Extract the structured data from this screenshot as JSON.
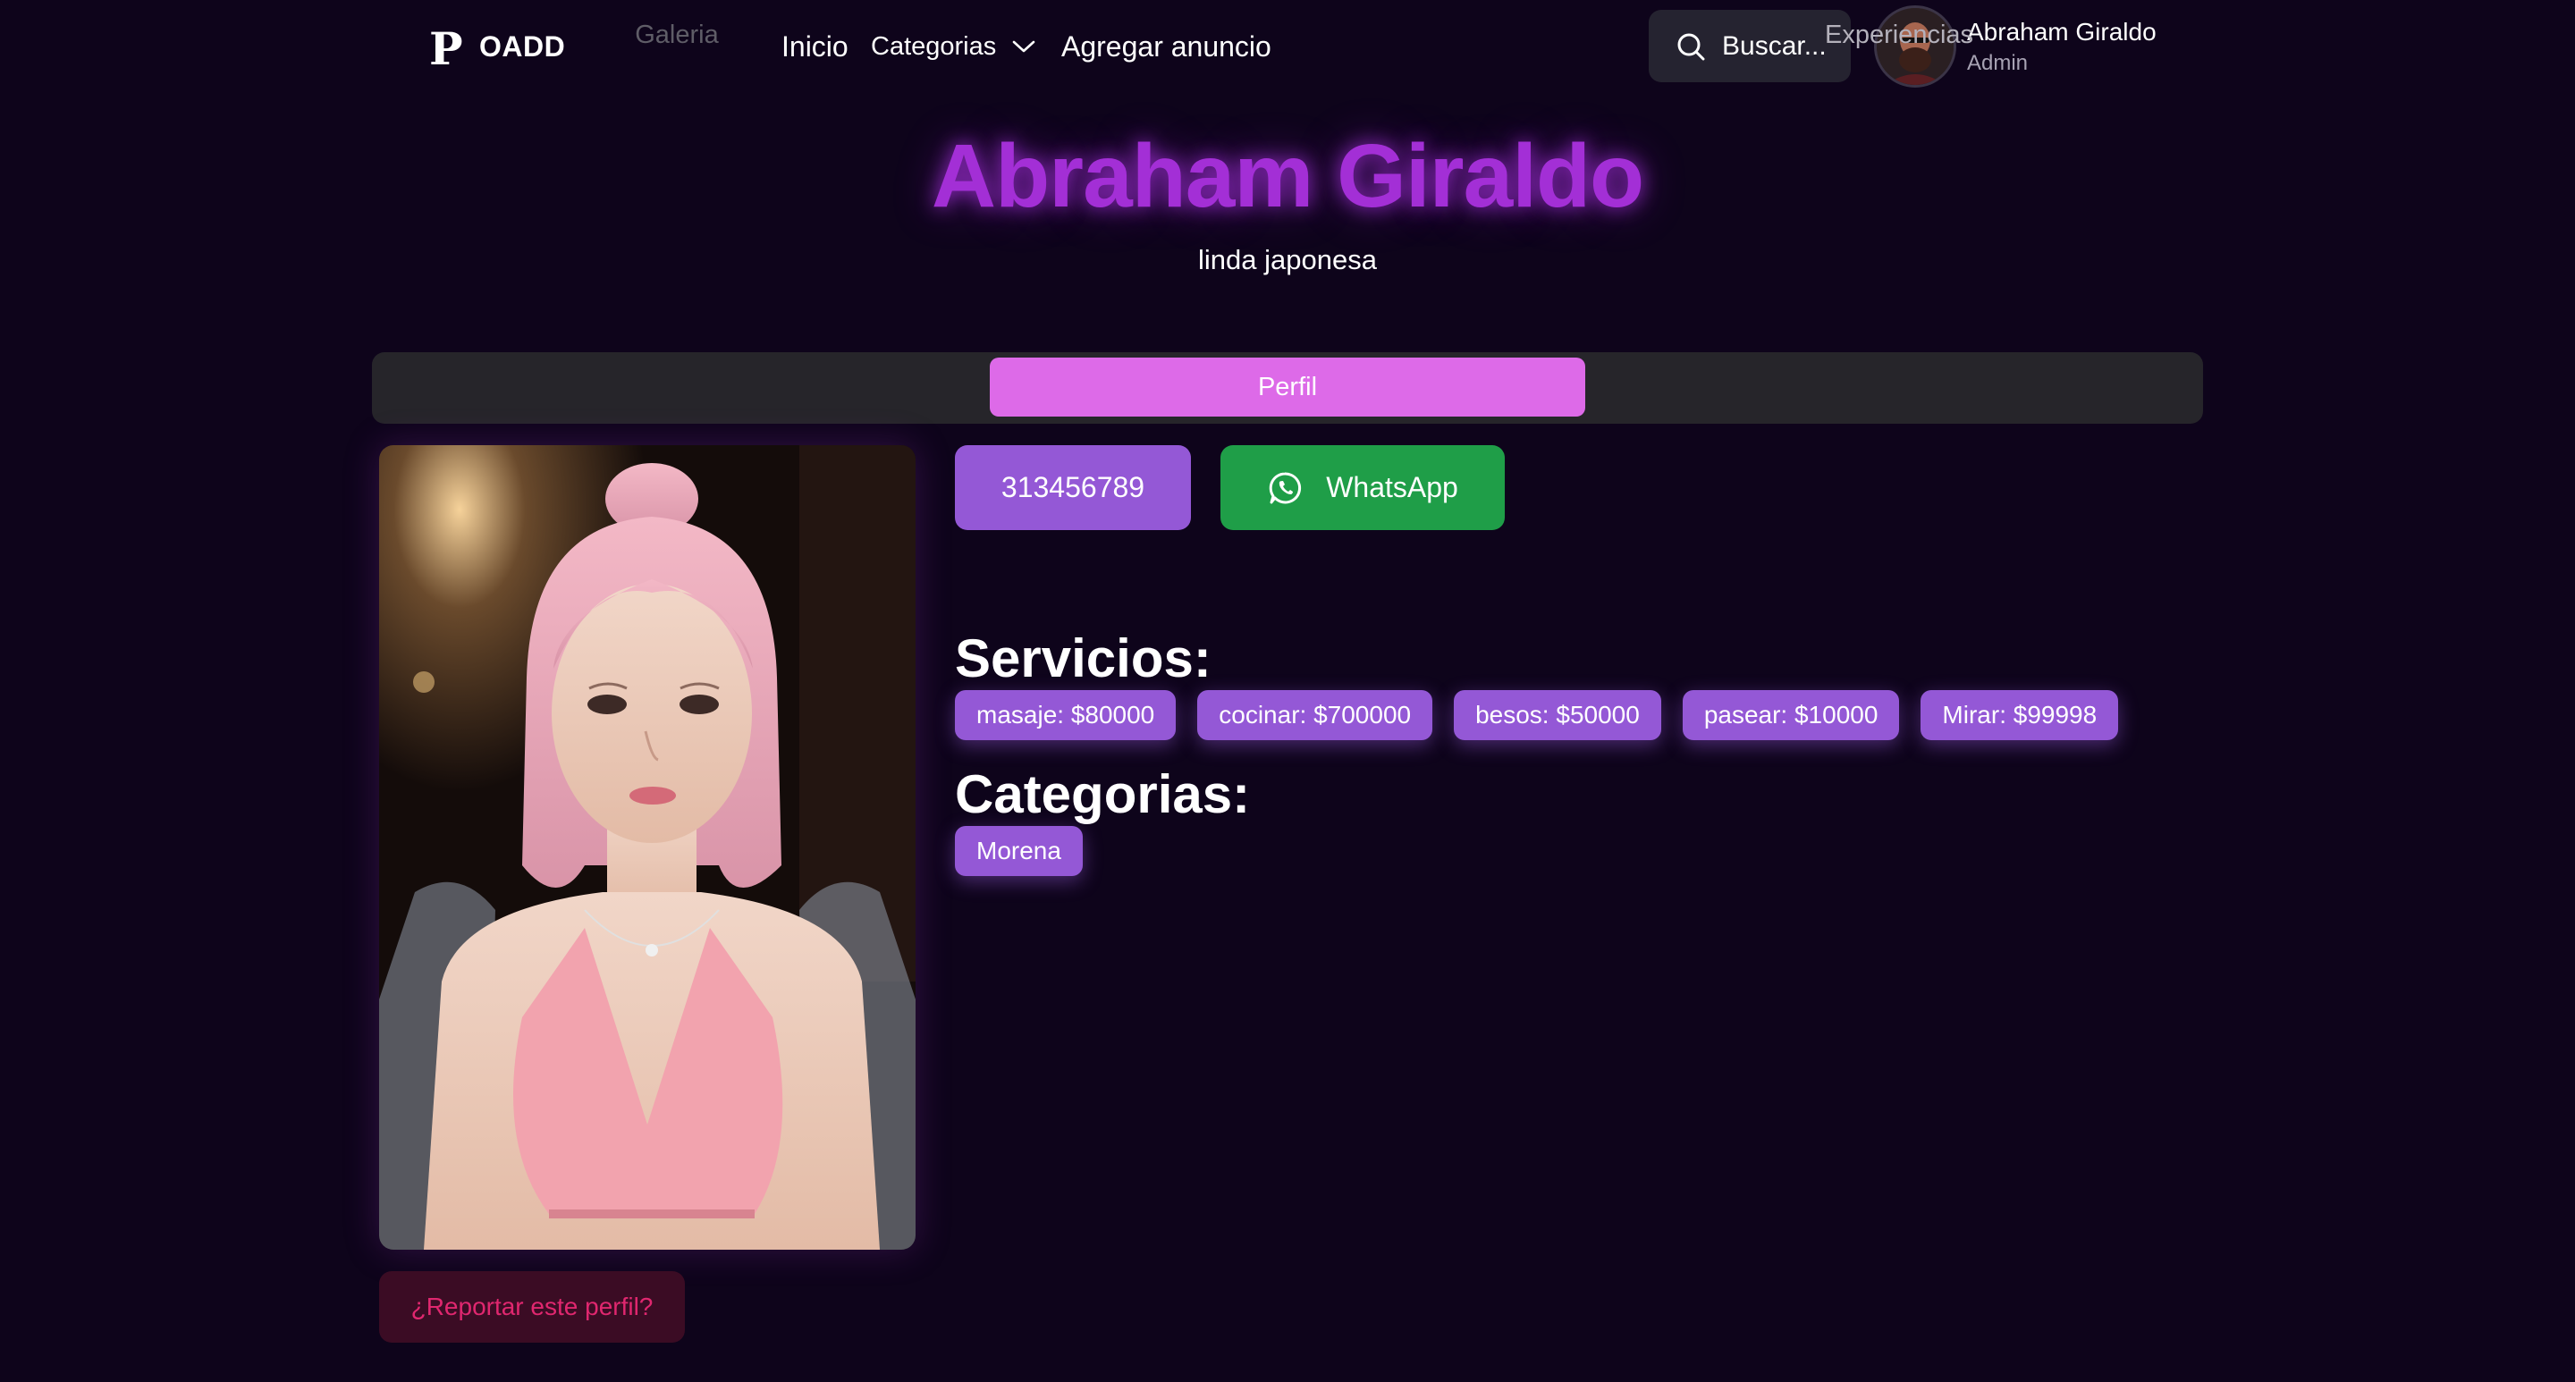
{
  "nav": {
    "logo_mark": "P",
    "brand": "OADD",
    "home": "Inicio",
    "categories": "Categorias",
    "add_listing": "Agregar anuncio",
    "search_label": "Buscar...",
    "user_name": "Abraham Giraldo",
    "user_role": "Admin"
  },
  "hero": {
    "title": "Abraham Giraldo",
    "subtitle": "linda japonesa"
  },
  "tabs": {
    "gallery": "Galeria",
    "profile": "Perfil",
    "experiences": "Experiencias",
    "active": "Perfil"
  },
  "contact": {
    "phone": "313456789",
    "whatsapp_label": "WhatsApp"
  },
  "services": {
    "title": "Servicios:",
    "items": [
      "masaje: $80000",
      "cocinar: $700000",
      "besos: $50000",
      "pasear: $10000",
      "Mirar: $99998"
    ]
  },
  "categories": {
    "title": "Categorias:",
    "items": [
      "Morena"
    ]
  },
  "report": {
    "label": "¿Reportar este perfil?"
  },
  "colors": {
    "background": "#0e041b",
    "accent_purple": "#9458d6",
    "tab_active": "#dd6ae8",
    "whatsapp_green": "#1f9e48",
    "title_glow": "#a32fd6",
    "report_text": "#e0276f"
  },
  "icons": {
    "search": "search-icon",
    "dropdown": "chevron-down-icon",
    "whatsapp": "whatsapp-icon"
  }
}
